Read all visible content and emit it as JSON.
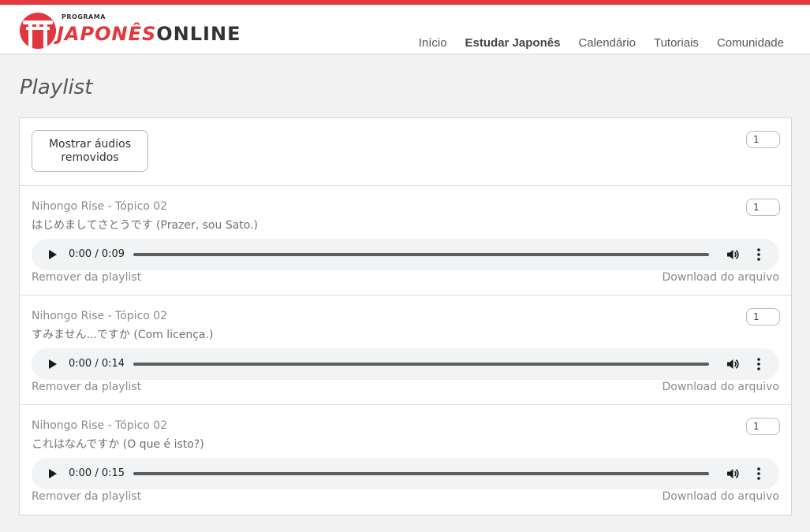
{
  "header": {
    "logo_small": "PROGRAMA",
    "logo_red": "JAPONÊS",
    "logo_dark": "ONLINE",
    "nav": [
      {
        "label": "Início",
        "active": false
      },
      {
        "label": "Estudar Japonês",
        "active": true
      },
      {
        "label": "Calendário",
        "active": false
      },
      {
        "label": "Tutoriais",
        "active": false
      },
      {
        "label": "Comunidade",
        "active": false
      }
    ],
    "accent_color": "#e0383e"
  },
  "page": {
    "title": "Playlist",
    "toolbar": {
      "show_removed_button": "Mostrar áudios removidos",
      "count_value": "1"
    },
    "items": [
      {
        "title": "Nihongo Rise - Tópico 02",
        "subtitle": "はじめましてさとうです (Prazer, sou Sato.)",
        "count_value": "1",
        "time": "0:00 / 0:09",
        "remove_label": "Remover da playlist",
        "download_label": "Download do arquivo"
      },
      {
        "title": "Nihongo Rise - Tópico 02",
        "subtitle": "すみません...ですか (Com licença.)",
        "count_value": "1",
        "time": "0:00 / 0:14",
        "remove_label": "Remover da playlist",
        "download_label": "Download do arquivo"
      },
      {
        "title": "Nihongo Rise - Tópico 02",
        "subtitle": "これはなんですか (O que é isto?)",
        "count_value": "1",
        "time": "0:00 / 0:15",
        "remove_label": "Remover da playlist",
        "download_label": "Download do arquivo"
      }
    ],
    "icons": {
      "logo": "torii-gate-icon",
      "play": "play-icon",
      "volume": "volume-icon",
      "more": "more-vertical-icon"
    }
  }
}
